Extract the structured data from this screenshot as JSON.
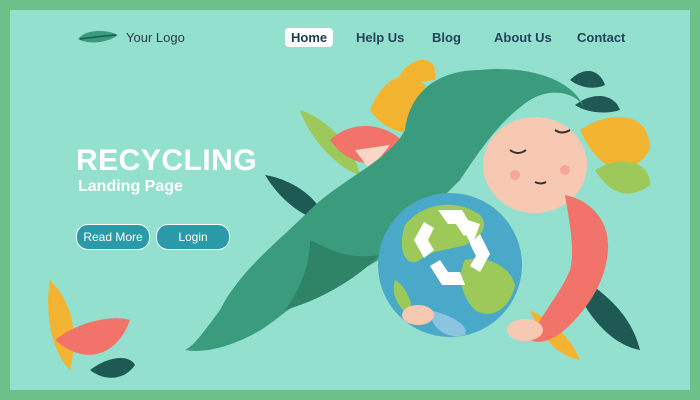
{
  "logo": {
    "text": "Your Logo",
    "icon": "leaf-icon"
  },
  "nav": {
    "items": [
      {
        "label": "Home",
        "active": true
      },
      {
        "label": "Help Us",
        "active": false
      },
      {
        "label": "Blog",
        "active": false
      },
      {
        "label": "About Us",
        "active": false
      },
      {
        "label": "Contact",
        "active": false
      }
    ]
  },
  "hero": {
    "title": "RECYCLING",
    "subtitle": "Landing Page"
  },
  "buttons": {
    "read_more": "Read More",
    "login": "Login"
  },
  "colors": {
    "background": "#94e0cf",
    "border": "#6cc18b",
    "button": "#2a9aa8",
    "hair": "#3a9c7d",
    "earth_blue": "#4aa9c9",
    "earth_green": "#9cc95a",
    "sweater": "#f2736a"
  }
}
